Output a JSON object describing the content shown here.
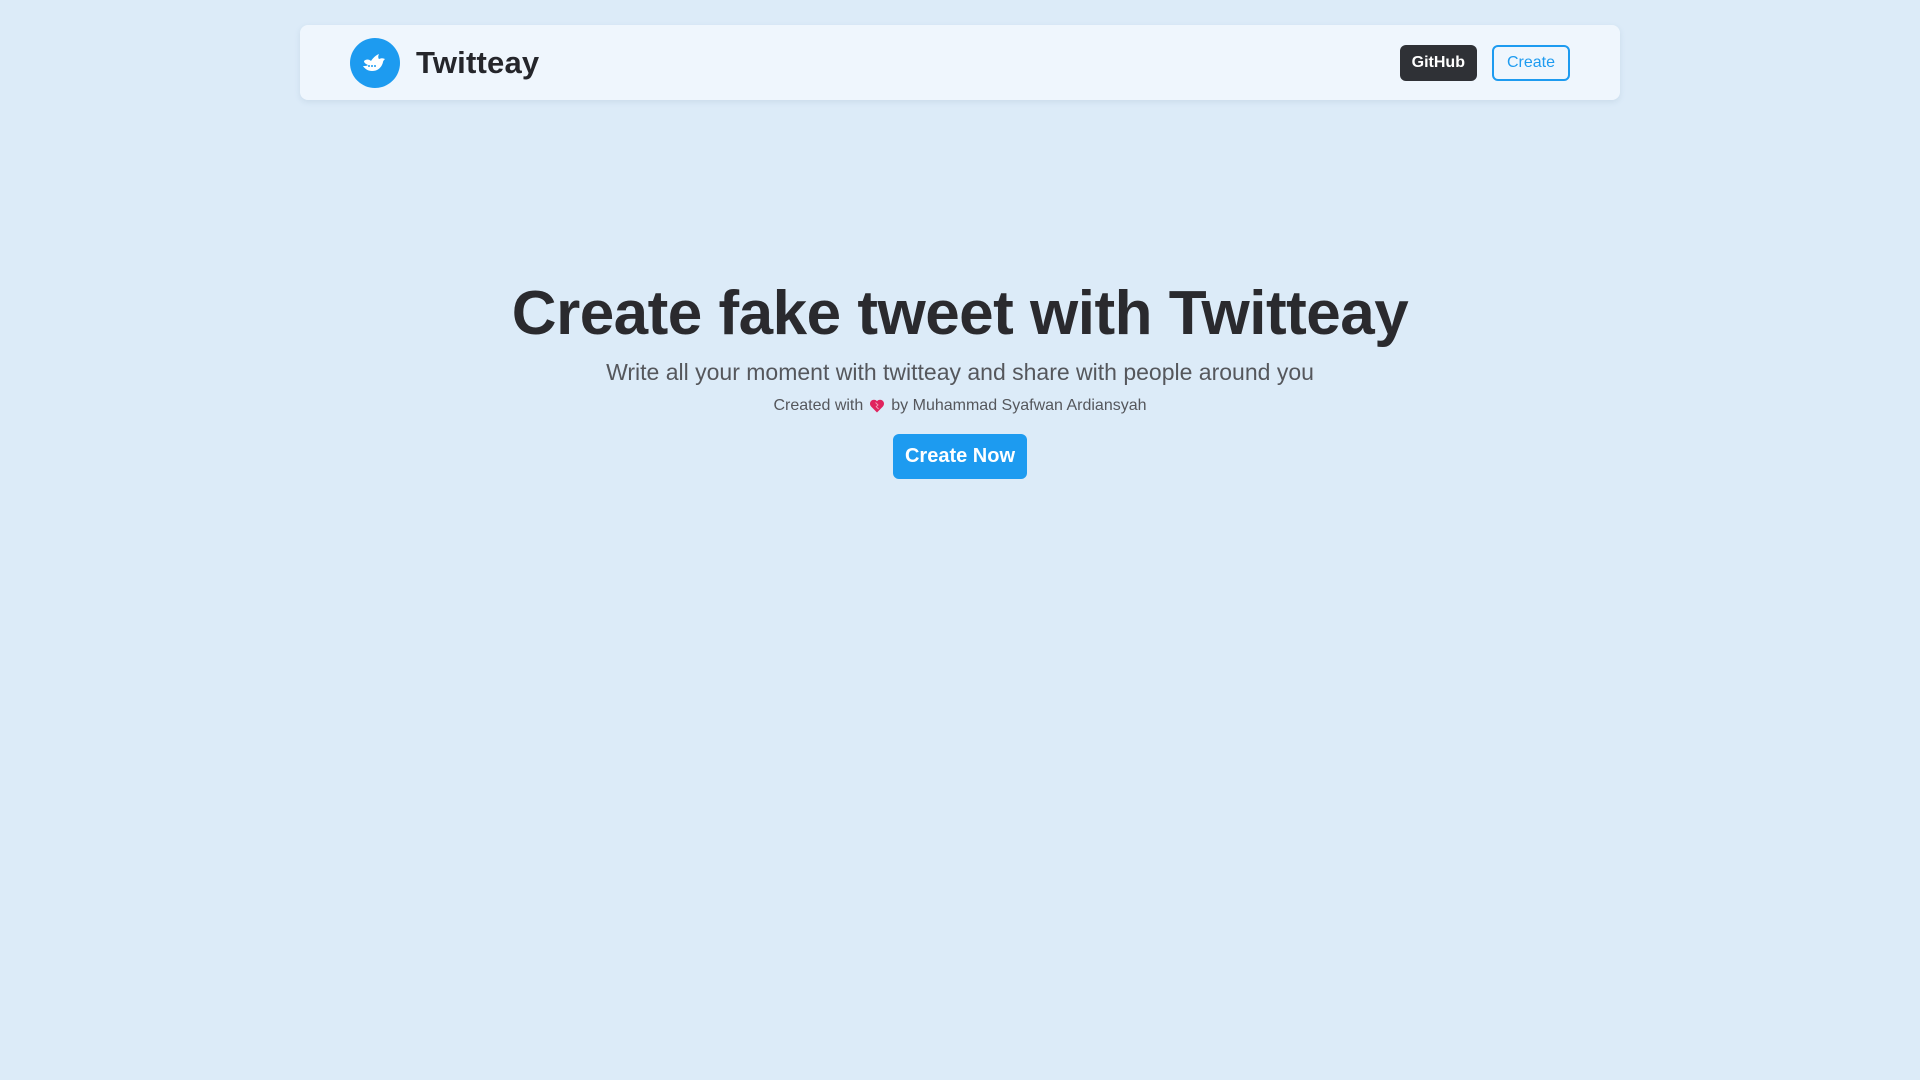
{
  "colors": {
    "background": "#dcebf8",
    "navbar_background": "#eff6fd",
    "accent": "#1d9bf0",
    "dark_button": "#2f3136",
    "heading_text": "#2a2a2e",
    "muted_text": "#55575c",
    "heart": "#e0245e"
  },
  "navbar": {
    "logo_icon": "bird-icon",
    "brand_name": "Twitteay",
    "github_label": "GitHub",
    "create_label": "Create"
  },
  "hero": {
    "title": "Create fake tweet with Twitteay",
    "subtitle": "Write all your moment with twitteay and share with people around you",
    "credit_prefix": "Created with",
    "credit_icon": "heart-icon",
    "credit_suffix": "by Muhammad Syafwan Ardiansyah",
    "cta_label": "Create Now"
  }
}
